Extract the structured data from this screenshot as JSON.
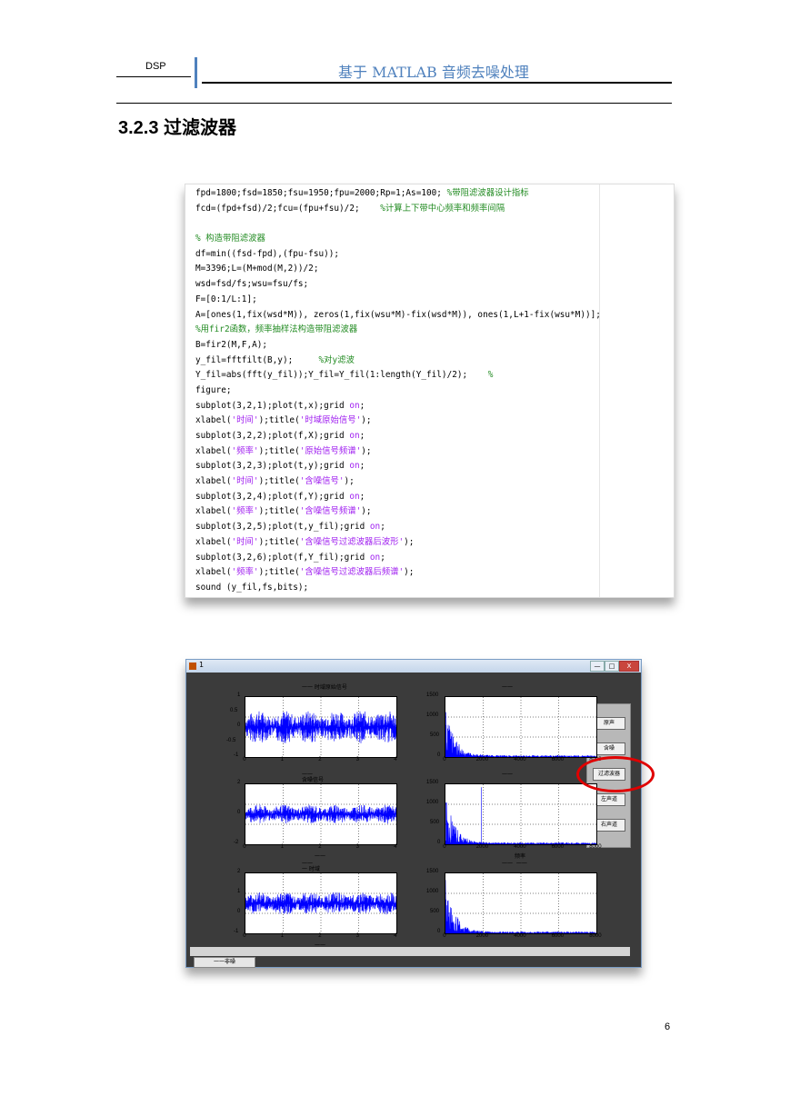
{
  "header": {
    "left_label": "DSP",
    "title": "基于 MATLAB 音频去噪处理",
    "accent_color": "#4f81bd"
  },
  "section_title": "3.2.3 过滤波器",
  "code": [
    [
      [
        "c",
        "fpd=1800;fsd=1850;fsu=1950;fpu=2000;Rp=1;As=100; "
      ],
      [
        "m",
        "%带阻滤波器设计指标"
      ]
    ],
    [
      [
        "c",
        "fcd=(fpd+fsd)/2;fcu=(fpu+fsu)/2;    "
      ],
      [
        "m",
        "%计算上下带中心频率和频率间隔"
      ]
    ],
    [],
    [
      [
        "m",
        "% 构造带阻滤波器"
      ]
    ],
    [
      [
        "c",
        "df=min((fsd-fpd),(fpu-fsu));"
      ]
    ],
    [
      [
        "c",
        "M=3396;L=(M+mod(M,2))/2;"
      ]
    ],
    [
      [
        "c",
        "wsd=fsd/fs;wsu=fsu/fs;"
      ]
    ],
    [
      [
        "c",
        "F=[0:1/L:1];"
      ]
    ],
    [
      [
        "c",
        "A=[ones(1,fix(wsd*M)), zeros(1,fix(wsu*M)-fix(wsd*M)), ones(1,L+1-fix(wsu*M))];"
      ]
    ],
    [
      [
        "m",
        "%用fir2函数，频率抽样法构造带阻滤波器"
      ]
    ],
    [
      [
        "c",
        "B=fir2(M,F,A);"
      ]
    ],
    [
      [
        "c",
        "y_fil=fftfilt(B,y);     "
      ],
      [
        "m",
        "%对y滤波"
      ]
    ],
    [
      [
        "c",
        "Y_fil=abs(fft(y_fil));Y_fil=Y_fil(1:length(Y_fil)/2);    "
      ],
      [
        "m",
        "%"
      ]
    ],
    [
      [
        "c",
        "figure;"
      ]
    ],
    [
      [
        "c",
        "subplot(3,2,1);plot(t,x);grid "
      ],
      [
        "s",
        "on"
      ],
      [
        "c",
        ";"
      ]
    ],
    [
      [
        "c",
        "xlabel("
      ],
      [
        "s",
        "'时间'"
      ],
      [
        "c",
        ");title("
      ],
      [
        "s",
        "'时域原始信号'"
      ],
      [
        "c",
        ");"
      ]
    ],
    [
      [
        "c",
        "subplot(3,2,2);plot(f,X);grid "
      ],
      [
        "s",
        "on"
      ],
      [
        "c",
        ";"
      ]
    ],
    [
      [
        "c",
        "xlabel("
      ],
      [
        "s",
        "'频率'"
      ],
      [
        "c",
        ");title("
      ],
      [
        "s",
        "'原始信号频谱'"
      ],
      [
        "c",
        ");"
      ]
    ],
    [
      [
        "c",
        "subplot(3,2,3);plot(t,y);grid "
      ],
      [
        "s",
        "on"
      ],
      [
        "c",
        ";"
      ]
    ],
    [
      [
        "c",
        "xlabel("
      ],
      [
        "s",
        "'时间'"
      ],
      [
        "c",
        ");title("
      ],
      [
        "s",
        "'含噪信号'"
      ],
      [
        "c",
        ");"
      ]
    ],
    [
      [
        "c",
        "subplot(3,2,4);plot(f,Y);grid "
      ],
      [
        "s",
        "on"
      ],
      [
        "c",
        ";"
      ]
    ],
    [
      [
        "c",
        "xlabel("
      ],
      [
        "s",
        "'频率'"
      ],
      [
        "c",
        ");title("
      ],
      [
        "s",
        "'含噪信号频谱'"
      ],
      [
        "c",
        ");"
      ]
    ],
    [
      [
        "c",
        "subplot(3,2,5);plot(t,y_fil);grid "
      ],
      [
        "s",
        "on"
      ],
      [
        "c",
        ";"
      ]
    ],
    [
      [
        "c",
        "xlabel("
      ],
      [
        "s",
        "'时间'"
      ],
      [
        "c",
        ");title("
      ],
      [
        "s",
        "'含噪信号过滤波器后波形'"
      ],
      [
        "c",
        ");"
      ]
    ],
    [
      [
        "c",
        "subplot(3,2,6);plot(f,Y_fil);grid "
      ],
      [
        "s",
        "on"
      ],
      [
        "c",
        ";"
      ]
    ],
    [
      [
        "c",
        "xlabel("
      ],
      [
        "s",
        "'频率'"
      ],
      [
        "c",
        ");title("
      ],
      [
        "s",
        "'含噪信号过滤波器后频谱'"
      ],
      [
        "c",
        ");"
      ]
    ],
    [
      [
        "c",
        "sound (y_fil,fs,bits);"
      ]
    ]
  ],
  "code_colors": {
    "code": "#000000",
    "comment": "#228b22",
    "string": "#a020f0"
  },
  "matlab_window": {
    "title": "1",
    "min_label": "—",
    "max_label": "□",
    "close_label": "X",
    "buttons": [
      "原声",
      "含噪",
      "过滤波器",
      "左声道",
      "右声道"
    ],
    "status_tab": "一一非噪",
    "plots": [
      {
        "title": "一一 时域原始信号",
        "xlabel": "",
        "y_ticks": [
          "1",
          "0.5",
          "0",
          "-0.5",
          "-1"
        ],
        "x_ticks": [
          "0",
          "1",
          "2",
          "3",
          "4"
        ],
        "ylim": [
          -1,
          1
        ],
        "kind": "wave",
        "amp": 0.55
      },
      {
        "title": "一一",
        "xlabel": "",
        "y_ticks": [
          "1500",
          "1000",
          "500",
          "0"
        ],
        "x_ticks": [
          "0",
          "2000",
          "4000",
          "6000",
          "8000"
        ],
        "ylim": [
          0,
          1500
        ],
        "kind": "spectrum",
        "spike": null
      },
      {
        "title": "一一\n含噪信号",
        "xlabel": "一一",
        "y_ticks": [
          "2",
          "0",
          "-2"
        ],
        "x_ticks": [
          "0",
          "1",
          "2",
          "3",
          "4"
        ],
        "ylim": [
          -2,
          2
        ],
        "kind": "wave",
        "amp": 0.32
      },
      {
        "title": "一一",
        "xlabel": "频率",
        "y_ticks": [
          "1500",
          "1000",
          "500",
          "0"
        ],
        "x_ticks": [
          "0",
          "2000",
          "4000",
          "6000",
          "8000"
        ],
        "ylim": [
          0,
          1500
        ],
        "kind": "spectrum",
        "spike": 1900
      },
      {
        "title": "一一\n一 时域",
        "xlabel": "一一",
        "y_ticks": [
          "2",
          "1",
          "0",
          "-1"
        ],
        "x_ticks": [
          "0",
          "1",
          "2",
          "3",
          "4"
        ],
        "ylim": [
          -1,
          2
        ],
        "kind": "wave",
        "amp": 0.38
      },
      {
        "title": "一一  一一",
        "xlabel": "",
        "y_ticks": [
          "1500",
          "1000",
          "500",
          "0"
        ],
        "x_ticks": [
          "0",
          "2000",
          "4000",
          "6000",
          "8000"
        ],
        "ylim": [
          0,
          1500
        ],
        "kind": "spectrum",
        "spike": null
      }
    ],
    "highlight_color": "#e00000",
    "highlighted_button": "过滤波器"
  },
  "page_number": "6"
}
